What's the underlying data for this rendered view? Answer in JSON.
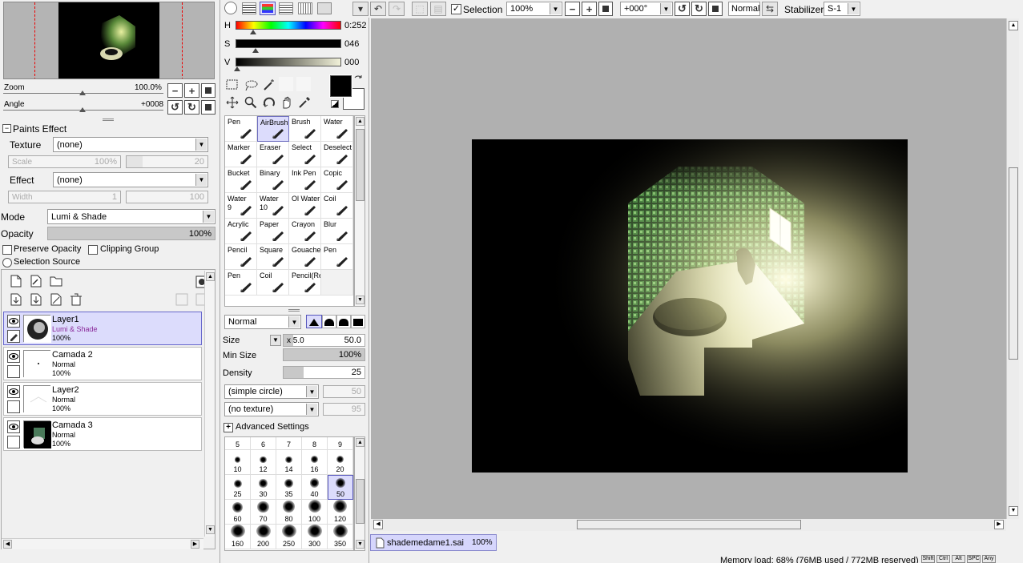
{
  "navigator": {
    "zoom_label": "Zoom",
    "zoom_value": "100.0%",
    "angle_label": "Angle",
    "angle_value": "+0008"
  },
  "paints_effect": {
    "title": "Paints Effect",
    "texture_label": "Texture",
    "texture_value": "(none)",
    "scale_label": "Scale",
    "scale_value": "100%",
    "scale_num": "20",
    "effect_label": "Effect",
    "effect_value": "(none)",
    "width_label": "Width",
    "width_value": "1",
    "width_num": "100"
  },
  "layer_props": {
    "mode_label": "Mode",
    "mode_value": "Lumi & Shade",
    "opacity_label": "Opacity",
    "opacity_value": "100%",
    "opacity_fraction": 1.0,
    "preserve_opacity": "Preserve Opacity",
    "clipping_group": "Clipping Group",
    "selection_source": "Selection Source"
  },
  "layers": [
    {
      "name": "Layer1",
      "mode": "Lumi & Shade",
      "opacity": "100%",
      "selected": true
    },
    {
      "name": "Camada 2",
      "mode": "Normal",
      "opacity": "100%",
      "selected": false
    },
    {
      "name": "Layer2",
      "mode": "Normal",
      "opacity": "100%",
      "selected": false
    },
    {
      "name": "Camada 3",
      "mode": "Normal",
      "opacity": "100%",
      "selected": false
    }
  ],
  "color": {
    "h_label": "H",
    "h_value": "0:252",
    "s_label": "S",
    "s_value": "046",
    "v_label": "V",
    "v_value": "000",
    "fg": "#000000",
    "bg": "#ffffff"
  },
  "tools": [
    {
      "name": "Pen",
      "name2": ""
    },
    {
      "name": "AirBrush",
      "name2": "",
      "selected": true
    },
    {
      "name": "Brush",
      "name2": ""
    },
    {
      "name": "Water",
      "name2": ""
    },
    {
      "name": "Marker",
      "name2": ""
    },
    {
      "name": "Eraser",
      "name2": ""
    },
    {
      "name": "Select",
      "name2": ""
    },
    {
      "name": "Deselect",
      "name2": ""
    },
    {
      "name": "Bucket",
      "name2": ""
    },
    {
      "name": "Binary",
      "name2": ""
    },
    {
      "name": "Ink Pen",
      "name2": ""
    },
    {
      "name": "Copic",
      "name2": ""
    },
    {
      "name": "Water",
      "name2": "9"
    },
    {
      "name": "Water",
      "name2": "10"
    },
    {
      "name": "Ol Water",
      "name2": ""
    },
    {
      "name": "Coil",
      "name2": ""
    },
    {
      "name": "Acrylic",
      "name2": ""
    },
    {
      "name": "Paper",
      "name2": ""
    },
    {
      "name": "Crayon",
      "name2": ""
    },
    {
      "name": "Blur",
      "name2": ""
    },
    {
      "name": "Pencil",
      "name2": ""
    },
    {
      "name": "Square",
      "name2": ""
    },
    {
      "name": "Gouache",
      "name2": ""
    },
    {
      "name": "Pen",
      "name2": ""
    },
    {
      "name": "Pen",
      "name2": ""
    },
    {
      "name": "Coil",
      "name2": ""
    },
    {
      "name": "Pencil(Re",
      "name2": ""
    },
    {
      "name": "",
      "name2": ""
    }
  ],
  "brush": {
    "blend_mode": "Normal",
    "size_label": "Size",
    "size_mult": "x 5.0",
    "size_value": "50.0",
    "min_size_label": "Min Size",
    "min_size_value": "100%",
    "min_size_fraction": 1.0,
    "density_label": "Density",
    "density_value": "25",
    "density_fraction": 0.25,
    "shape": "(simple circle)",
    "shape_num": "50",
    "texture": "(no texture)",
    "texture_num": "95",
    "advanced": "Advanced Settings",
    "sizes_header": [
      "5",
      "6",
      "7",
      "8",
      "9"
    ],
    "sizes": [
      "10",
      "12",
      "14",
      "16",
      "20",
      "25",
      "30",
      "35",
      "40",
      "50",
      "60",
      "70",
      "80",
      "100",
      "120",
      "160",
      "200",
      "250",
      "300",
      "350"
    ],
    "selected_size": "50"
  },
  "toolbar": {
    "selection_label": "Selection",
    "zoom_value": "100%",
    "angle_value": "+000°",
    "blend_value": "Normal",
    "stabilizer_label": "Stabilizer",
    "stabilizer_value": "S-1"
  },
  "document_tab": {
    "name": "shademedame1.sai",
    "zoom": "100%"
  },
  "status": {
    "memory": "Memory load: 68% (76MB used / 772MB reserved)",
    "keys": [
      "Shift",
      "Ctrl",
      "Alt",
      "SPC",
      "Any"
    ]
  }
}
